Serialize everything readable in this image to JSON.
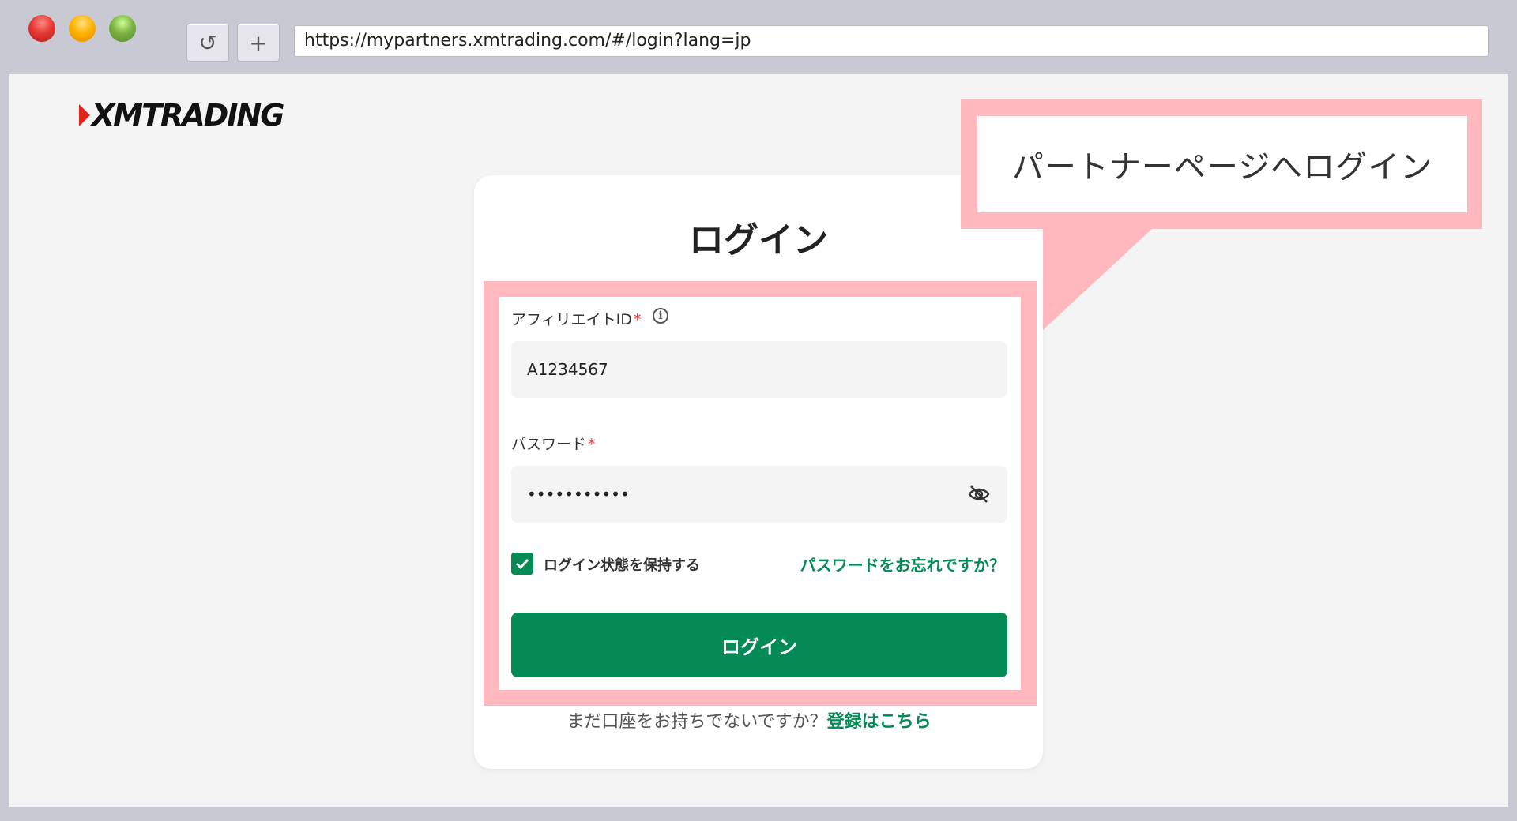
{
  "browser": {
    "url": "https://mypartners.xmtrading.com/#/login?lang=jp",
    "reload_icon": "↺",
    "newtab_icon": "+"
  },
  "logo": {
    "text": "XMTRADING"
  },
  "login": {
    "title": "ログイン",
    "affiliate_label": "アフィリエイトID",
    "required_mark": "*",
    "affiliate_value": "A1234567",
    "password_label": "パスワード",
    "password_value": "•••••••••••",
    "remember_label": "ログイン状態を保持する",
    "remember_checked": true,
    "forgot_link": "パスワードをお忘れですか？",
    "submit_label": "ログイン",
    "signup_prompt": "まだ口座をお持ちでないですか？",
    "signup_link": "登録はこちら"
  },
  "callout": {
    "text": "パートナーページへログイン"
  },
  "colors": {
    "accent": "#038a55",
    "highlight": "#ffb8bd",
    "required": "#e53935"
  }
}
